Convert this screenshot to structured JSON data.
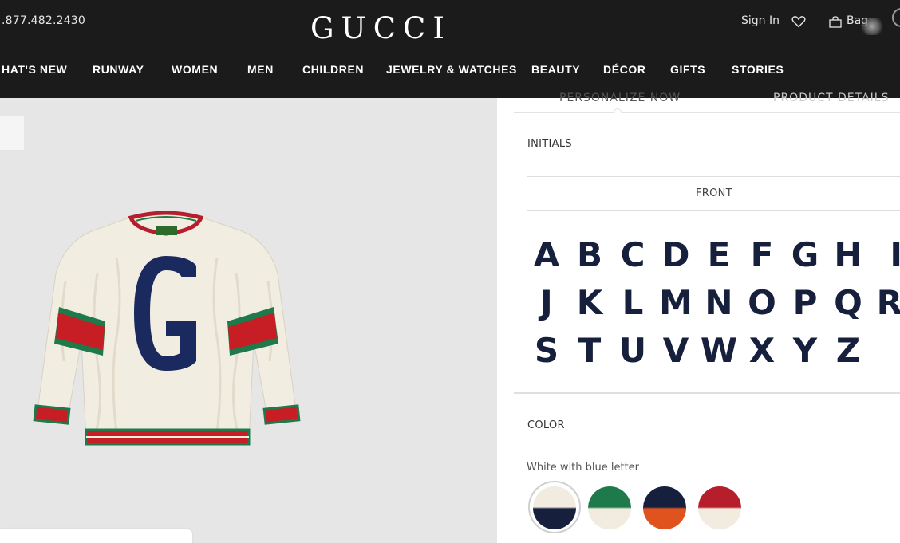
{
  "header": {
    "phone": ".877.482.2430",
    "logo": "GUCCI",
    "sign_in": "Sign In",
    "bag": "Bag",
    "icons": [
      "heart-icon",
      "bag-icon"
    ]
  },
  "nav": {
    "items": [
      "HAT'S NEW",
      "RUNWAY",
      "WOMEN",
      "MEN",
      "CHILDREN",
      "JEWELRY & WATCHES",
      "BEAUTY",
      "DÉCOR",
      "GIFTS",
      "STORIES"
    ]
  },
  "product": {
    "image": "cream cable-knit sweater with navy G and green-red-green web stripes"
  },
  "personalize": {
    "tabs": [
      "PERSONALIZE NOW",
      "PRODUCT DETAILS"
    ],
    "active_tab": "PERSONALIZE NOW",
    "initials_label": "INITIALS",
    "placement": "FRONT",
    "letters": [
      "A",
      "B",
      "C",
      "D",
      "E",
      "F",
      "G",
      "H",
      "I",
      "J",
      "K",
      "L",
      "M",
      "N",
      "O",
      "P",
      "Q",
      "R",
      "S",
      "T",
      "U",
      "V",
      "W",
      "X",
      "Y",
      "Z"
    ],
    "color_label": "COLOR",
    "selected_color": "White with blue letter",
    "swatches": [
      {
        "name": "White with blue letter",
        "top": "#f1ebe0",
        "bottom": "#16203d",
        "selected": true
      },
      {
        "name": "Green and white",
        "top": "#1e7a4a",
        "bottom": "#f1ebe0",
        "selected": false
      },
      {
        "name": "Navy and orange",
        "top": "#16203d",
        "bottom": "#e0521e",
        "selected": false
      },
      {
        "name": "Red and white",
        "top": "#b51e2a",
        "bottom": "#f1ebe0",
        "selected": false
      }
    ]
  },
  "colors": {
    "header_bg": "#1b1b1b",
    "product_bg": "#e6e6e6",
    "letter": "#16203d"
  }
}
